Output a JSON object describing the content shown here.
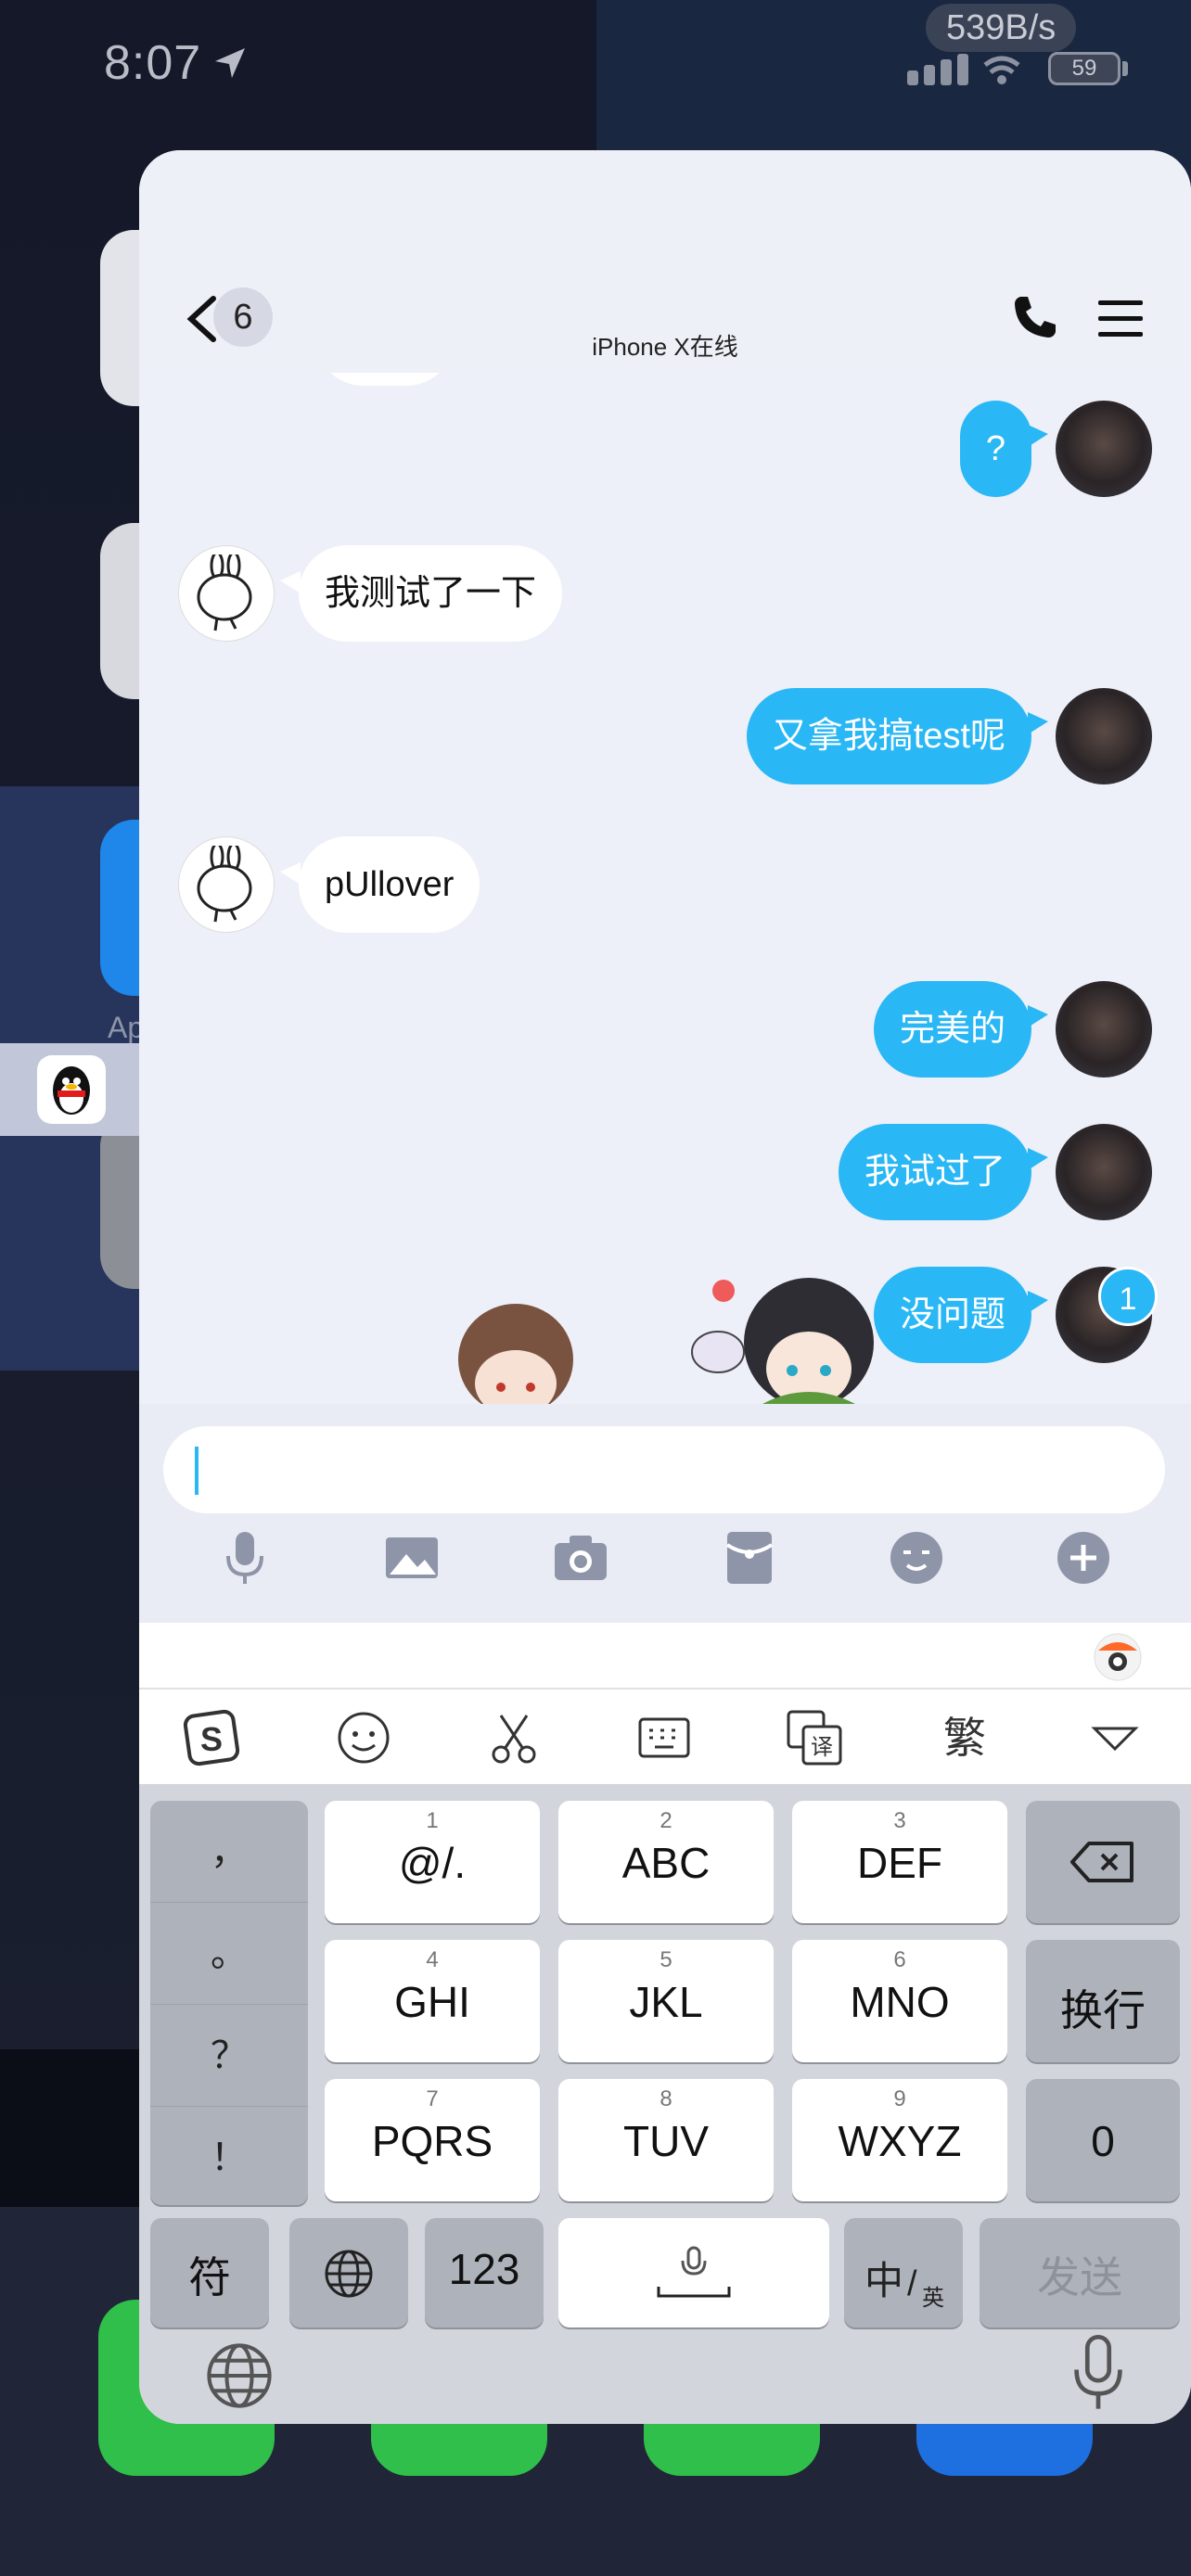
{
  "status_bar": {
    "time": "8:07",
    "net_speed": "539B/s",
    "battery": "59"
  },
  "background": {
    "partial_label": "Ap"
  },
  "nav": {
    "back_count": "6",
    "device_status": "iPhone X在线"
  },
  "messages": [
    {
      "side": "out",
      "text": "?"
    },
    {
      "side": "in",
      "text": "我测试了一下"
    },
    {
      "side": "out",
      "text": "又拿我搞test呢"
    },
    {
      "side": "in",
      "text": "pUllover"
    },
    {
      "side": "out",
      "text": "完美的"
    },
    {
      "side": "out",
      "text": "我试过了"
    },
    {
      "side": "out",
      "text": "没问题"
    }
  ],
  "unread_badge": "1",
  "input": {
    "value": "",
    "placeholder": ""
  },
  "toolbar_icons": [
    "microphone-icon",
    "image-icon",
    "camera-icon",
    "red-packet-icon",
    "emoji-icon",
    "plus-icon"
  ],
  "keyboard": {
    "tools": [
      "sogou-logo-icon",
      "smiley-icon",
      "scissors-icon",
      "keyboard-icon",
      "translate-icon",
      "繁",
      "collapse-icon"
    ],
    "punctuation": [
      "，",
      "。",
      "？",
      "！"
    ],
    "keys": [
      {
        "num": "1",
        "label": "@/."
      },
      {
        "num": "2",
        "label": "ABC"
      },
      {
        "num": "3",
        "label": "DEF"
      },
      {
        "num": "4",
        "label": "GHI"
      },
      {
        "num": "5",
        "label": "JKL"
      },
      {
        "num": "6",
        "label": "MNO"
      },
      {
        "num": "7",
        "label": "PQRS"
      },
      {
        "num": "8",
        "label": "TUV"
      },
      {
        "num": "9",
        "label": "WXYZ"
      }
    ],
    "newline": "换行",
    "zero": "0",
    "symbols": "符",
    "num_mode": "123",
    "lang_main": "中",
    "lang_sub": "英",
    "send": "发送"
  },
  "colors": {
    "accent": "#2ab7f5",
    "card": "#edf0f8",
    "keyboard_bg": "#d2d5db"
  }
}
